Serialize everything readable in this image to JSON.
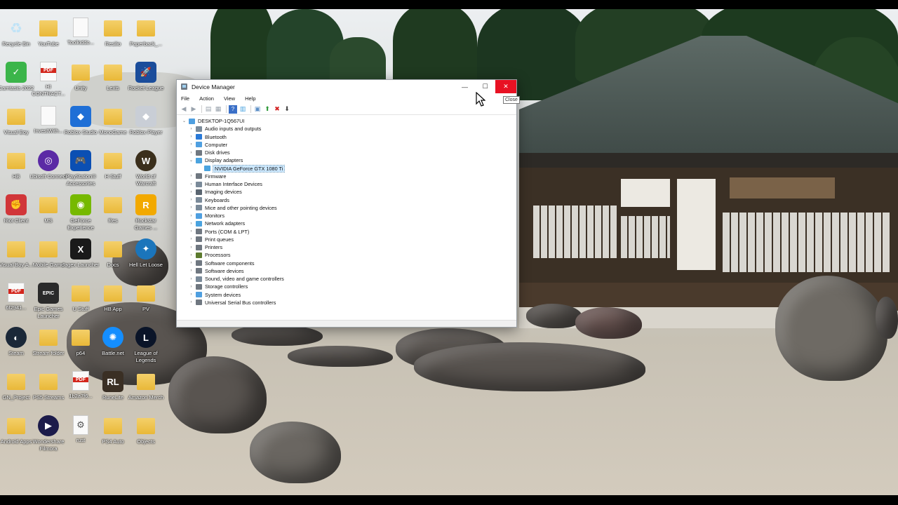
{
  "desktop": {
    "icons": [
      {
        "label": "Recycle Bin",
        "glyph": "♻",
        "type": "bin"
      },
      {
        "label": "YouTube",
        "glyph": "",
        "type": "folder"
      },
      {
        "label": "Toolkiddo...",
        "glyph": "",
        "type": "doc"
      },
      {
        "label": "Resilio",
        "glyph": "",
        "type": "folder"
      },
      {
        "label": "Paperback_...",
        "glyph": "",
        "type": "folder"
      },
      {
        "label": "Camtasia 2022",
        "glyph": "✓",
        "type": "app",
        "color": "#3bb54a"
      },
      {
        "label": "HI CONTRACT...",
        "glyph": "",
        "type": "pdf"
      },
      {
        "label": "Unity",
        "glyph": "",
        "type": "folder"
      },
      {
        "label": "Lexis",
        "glyph": "",
        "type": "folder"
      },
      {
        "label": "Rocket League",
        "glyph": "🚀",
        "type": "app",
        "color": "#1b4d9b"
      },
      {
        "label": "Visual Boy",
        "glyph": "",
        "type": "folder"
      },
      {
        "label": "InvestWith...",
        "glyph": "",
        "type": "doc"
      },
      {
        "label": "Roblox Studio",
        "glyph": "◆",
        "type": "app",
        "color": "#1f6fd6"
      },
      {
        "label": "MonoGame",
        "glyph": "",
        "type": "folder"
      },
      {
        "label": "Roblox Player",
        "glyph": "◆",
        "type": "app",
        "color": "#c9ced6"
      },
      {
        "label": "HB",
        "glyph": "",
        "type": "folder"
      },
      {
        "label": "Ubisoft Connect",
        "glyph": "◎",
        "type": "app-round",
        "color": "#5b2aa5"
      },
      {
        "label": "PlayStation® Accessories",
        "glyph": "🎮",
        "type": "app",
        "color": "#0b4fb3"
      },
      {
        "label": "H Stuff",
        "glyph": "",
        "type": "folder"
      },
      {
        "label": "World of Warcraft",
        "glyph": "W",
        "type": "app-round",
        "color": "#3b2f1c"
      },
      {
        "label": "Riot Client",
        "glyph": "✊",
        "type": "app",
        "color": "#d13639"
      },
      {
        "label": "MS",
        "glyph": "",
        "type": "folder"
      },
      {
        "label": "GeForce Experience",
        "glyph": "◉",
        "type": "app",
        "color": "#76b900"
      },
      {
        "label": "Res",
        "glyph": "",
        "type": "folder"
      },
      {
        "label": "Rockstar Games ...",
        "glyph": "R",
        "type": "app",
        "color": "#f2a900"
      },
      {
        "label": "Visual Boy A...",
        "glyph": "",
        "type": "folder"
      },
      {
        "label": "Mobile Game",
        "glyph": "",
        "type": "folder"
      },
      {
        "label": "Jagex Launcher",
        "glyph": "X",
        "type": "app",
        "color": "#1a1a1a"
      },
      {
        "label": "Docs",
        "glyph": "",
        "type": "folder"
      },
      {
        "label": "Hell Let Loose",
        "glyph": "✦",
        "type": "app-round",
        "color": "#1b75bb"
      },
      {
        "label": "6f2941...",
        "glyph": "",
        "type": "pdf"
      },
      {
        "label": "Epic Games Launcher",
        "glyph": "EPIC",
        "type": "app",
        "color": "#2a2a2a"
      },
      {
        "label": "U Stuff",
        "glyph": "",
        "type": "folder"
      },
      {
        "label": "HB App",
        "glyph": "",
        "type": "folder"
      },
      {
        "label": "PV",
        "glyph": "",
        "type": "folder"
      },
      {
        "label": "Steam",
        "glyph": "◐",
        "type": "app-round",
        "color": "#1b2838"
      },
      {
        "label": "Stream folder",
        "glyph": "",
        "type": "folder"
      },
      {
        "label": "p64",
        "glyph": "",
        "type": "folder"
      },
      {
        "label": "Battle.net",
        "glyph": "✺",
        "type": "app-round",
        "color": "#148eff"
      },
      {
        "label": "League of Legends",
        "glyph": "L",
        "type": "app-round",
        "color": "#0a1428"
      },
      {
        "label": "GN_Project",
        "glyph": "",
        "type": "folder"
      },
      {
        "label": "PS5 Streams",
        "glyph": "",
        "type": "folder"
      },
      {
        "label": "1b2a7f6...",
        "glyph": "",
        "type": "pdf"
      },
      {
        "label": "RuneLite",
        "glyph": "RL",
        "type": "app",
        "color": "#3a2f24"
      },
      {
        "label": "Amazon Merch",
        "glyph": "",
        "type": "folder"
      },
      {
        "label": "Android Apps",
        "glyph": "",
        "type": "folder"
      },
      {
        "label": "Wondershare Filmora",
        "glyph": "▶",
        "type": "app-round",
        "color": "#1c1b4a"
      },
      {
        "label": "rust",
        "glyph": "⚙",
        "type": "doc"
      },
      {
        "label": "PS4 Auto",
        "glyph": "",
        "type": "folder"
      },
      {
        "label": "Objects",
        "glyph": "",
        "type": "folder"
      }
    ]
  },
  "window": {
    "title": "Device Manager",
    "controls": {
      "minimize": "—",
      "maximize": "☐",
      "close": "✕"
    },
    "menu": [
      "File",
      "Action",
      "View",
      "Help"
    ],
    "toolbar": [
      {
        "name": "back-icon",
        "glyph": "◀"
      },
      {
        "name": "forward-icon",
        "glyph": "▶"
      },
      {
        "name": "properties-pane-icon",
        "glyph": "▤"
      },
      {
        "name": "properties-icon",
        "glyph": "▦"
      },
      {
        "name": "help-icon",
        "glyph": "?"
      },
      {
        "name": "view-icon",
        "glyph": "▥"
      },
      {
        "name": "scan-hardware-icon",
        "glyph": "▣"
      },
      {
        "name": "update-driver-icon",
        "glyph": "⬆"
      },
      {
        "name": "uninstall-device-icon",
        "glyph": "✖"
      },
      {
        "name": "disable-device-icon",
        "glyph": "⬇"
      }
    ],
    "tree": {
      "root": "DESKTOP-1Q567UI",
      "categories": [
        {
          "label": "Audio inputs and outputs",
          "icon": "speaker-icon",
          "color": "#7a8a99",
          "expanded": false
        },
        {
          "label": "Bluetooth",
          "icon": "bluetooth-icon",
          "color": "#2a7ad8",
          "expanded": false
        },
        {
          "label": "Computer",
          "icon": "computer-icon",
          "color": "#4f9fe0",
          "expanded": false
        },
        {
          "label": "Disk drives",
          "icon": "disk-icon",
          "color": "#6f7780",
          "expanded": false
        },
        {
          "label": "Display adapters",
          "icon": "display-adapter-icon",
          "color": "#4aa3df",
          "expanded": true,
          "children": [
            "NVIDIA GeForce GTX 1080 Ti"
          ]
        },
        {
          "label": "Firmware",
          "icon": "firmware-icon",
          "color": "#6f7780",
          "expanded": false
        },
        {
          "label": "Human Interface Devices",
          "icon": "hid-icon",
          "color": "#7a8a99",
          "expanded": false
        },
        {
          "label": "Imaging devices",
          "icon": "camera-icon",
          "color": "#5a6570",
          "expanded": false
        },
        {
          "label": "Keyboards",
          "icon": "keyboard-icon",
          "color": "#7a8a99",
          "expanded": false
        },
        {
          "label": "Mice and other pointing devices",
          "icon": "mouse-icon",
          "color": "#7a8a99",
          "expanded": false
        },
        {
          "label": "Monitors",
          "icon": "monitor-icon",
          "color": "#4f9fe0",
          "expanded": false
        },
        {
          "label": "Network adapters",
          "icon": "network-icon",
          "color": "#4aa3df",
          "expanded": false
        },
        {
          "label": "Ports (COM & LPT)",
          "icon": "port-icon",
          "color": "#6f7780",
          "expanded": false
        },
        {
          "label": "Print queues",
          "icon": "print-queue-icon",
          "color": "#6f7780",
          "expanded": false
        },
        {
          "label": "Printers",
          "icon": "printer-icon",
          "color": "#6f7780",
          "expanded": false
        },
        {
          "label": "Processors",
          "icon": "processor-icon",
          "color": "#5c7a2e",
          "expanded": false
        },
        {
          "label": "Software components",
          "icon": "software-component-icon",
          "color": "#6f7780",
          "expanded": false
        },
        {
          "label": "Software devices",
          "icon": "software-device-icon",
          "color": "#6f7780",
          "expanded": false
        },
        {
          "label": "Sound, video and game controllers",
          "icon": "sound-icon",
          "color": "#7a8a99",
          "expanded": false
        },
        {
          "label": "Storage controllers",
          "icon": "storage-controller-icon",
          "color": "#6f7780",
          "expanded": false
        },
        {
          "label": "System devices",
          "icon": "system-device-icon",
          "color": "#4f9fe0",
          "expanded": false
        },
        {
          "label": "Universal Serial Bus controllers",
          "icon": "usb-icon",
          "color": "#6f7780",
          "expanded": false
        }
      ]
    }
  },
  "tooltip": "Close"
}
